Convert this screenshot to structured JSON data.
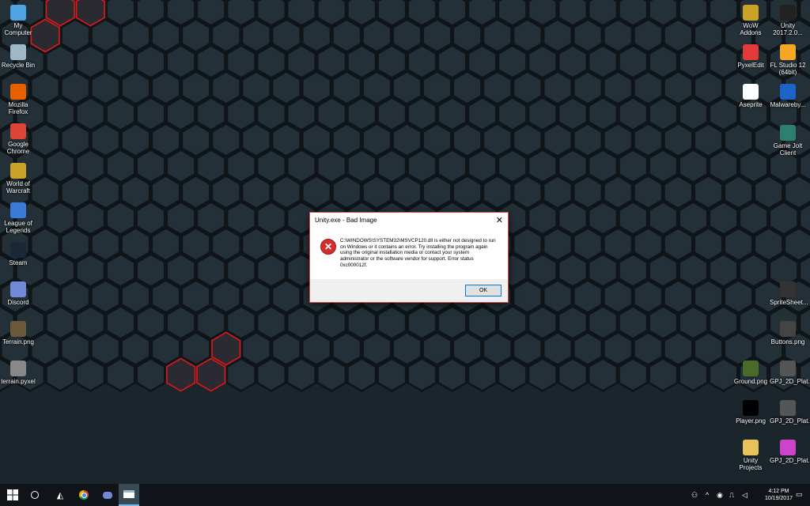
{
  "desktop": {
    "left_icons": [
      {
        "label": "My Computer",
        "icon": "my-computer-icon",
        "color": "#4fa3e0"
      },
      {
        "label": "Recycle Bin",
        "icon": "recycle-bin-icon",
        "color": "#9fb8c8"
      },
      {
        "label": "Mozilla Firefox",
        "icon": "firefox-icon",
        "color": "#e66000"
      },
      {
        "label": "Google Chrome",
        "icon": "chrome-icon",
        "color": "#db4437"
      },
      {
        "label": "World of Warcraft",
        "icon": "wow-icon",
        "color": "#c9a227"
      },
      {
        "label": "League of Legends",
        "icon": "league-icon",
        "color": "#3a7bd5"
      },
      {
        "label": "Steam",
        "icon": "steam-icon",
        "color": "#1b2838"
      },
      {
        "label": "Discord",
        "icon": "discord-icon",
        "color": "#7289da"
      },
      {
        "label": "Terrain.png",
        "icon": "image-file-icon",
        "color": "#6b5a3a"
      },
      {
        "label": "terrain.pyxel",
        "icon": "pyxel-file-icon",
        "color": "#888888"
      }
    ],
    "right_icons_col1": [
      {
        "label": "WoW Addons",
        "icon": "wow-addons-icon",
        "color": "#c9a227"
      },
      {
        "label": "PyxelEdit",
        "icon": "pyxeledit-icon",
        "color": "#e03a3a"
      },
      {
        "label": "Aseprite",
        "icon": "aseprite-icon",
        "color": "#ffffff"
      }
    ],
    "right_icons_col2": [
      {
        "label": "Unity 2017.2.0...",
        "icon": "unity-icon",
        "color": "#222222"
      },
      {
        "label": "FL Studio 12 (64bit)",
        "icon": "fl-studio-icon",
        "color": "#f5a623"
      },
      {
        "label": "Malwareby...",
        "icon": "malwarebytes-icon",
        "color": "#1e63c8"
      },
      {
        "label": "Game Jolt Client",
        "icon": "game-jolt-icon",
        "color": "#2f7f6f"
      },
      {
        "label": "SpriteSheet...",
        "icon": "spritesheet-icon",
        "color": "#333333"
      },
      {
        "label": "Buttons.png",
        "icon": "image-file-icon",
        "color": "#444444"
      },
      {
        "label": "GPJ_2D_Plat...",
        "icon": "file-icon",
        "color": "#555555"
      },
      {
        "label": "GPJ_2D_Plat...",
        "icon": "file-icon",
        "color": "#555555"
      },
      {
        "label": "GPJ_2D_Plat...",
        "icon": "file-icon",
        "color": "#cc44cc"
      }
    ],
    "right_icons_extra": [
      {
        "label": "Ground.png",
        "icon": "image-file-icon",
        "color": "#4a6a2a"
      },
      {
        "label": "Player.png",
        "icon": "image-file-icon",
        "color": "#000000"
      },
      {
        "label": "Unity Projects",
        "icon": "folder-icon",
        "color": "#e8c25a"
      }
    ]
  },
  "dialog": {
    "title": "Unity.exe - Bad Image",
    "message": "C:\\WINDOWS\\SYSTEM32\\MSVCP120.dll is either not designed to run on Windows or it contains an error. Try installing the program again using the original installation media or contact your system administrator or the software vendor for support. Error status 0xc000012f.",
    "ok_label": "OK",
    "close_glyph": "✕"
  },
  "taskbar": {
    "time": "4:12 PM",
    "date": "10/19/2017"
  },
  "colors": {
    "accent_red": "#e01616",
    "hex_fill": "#243038"
  }
}
